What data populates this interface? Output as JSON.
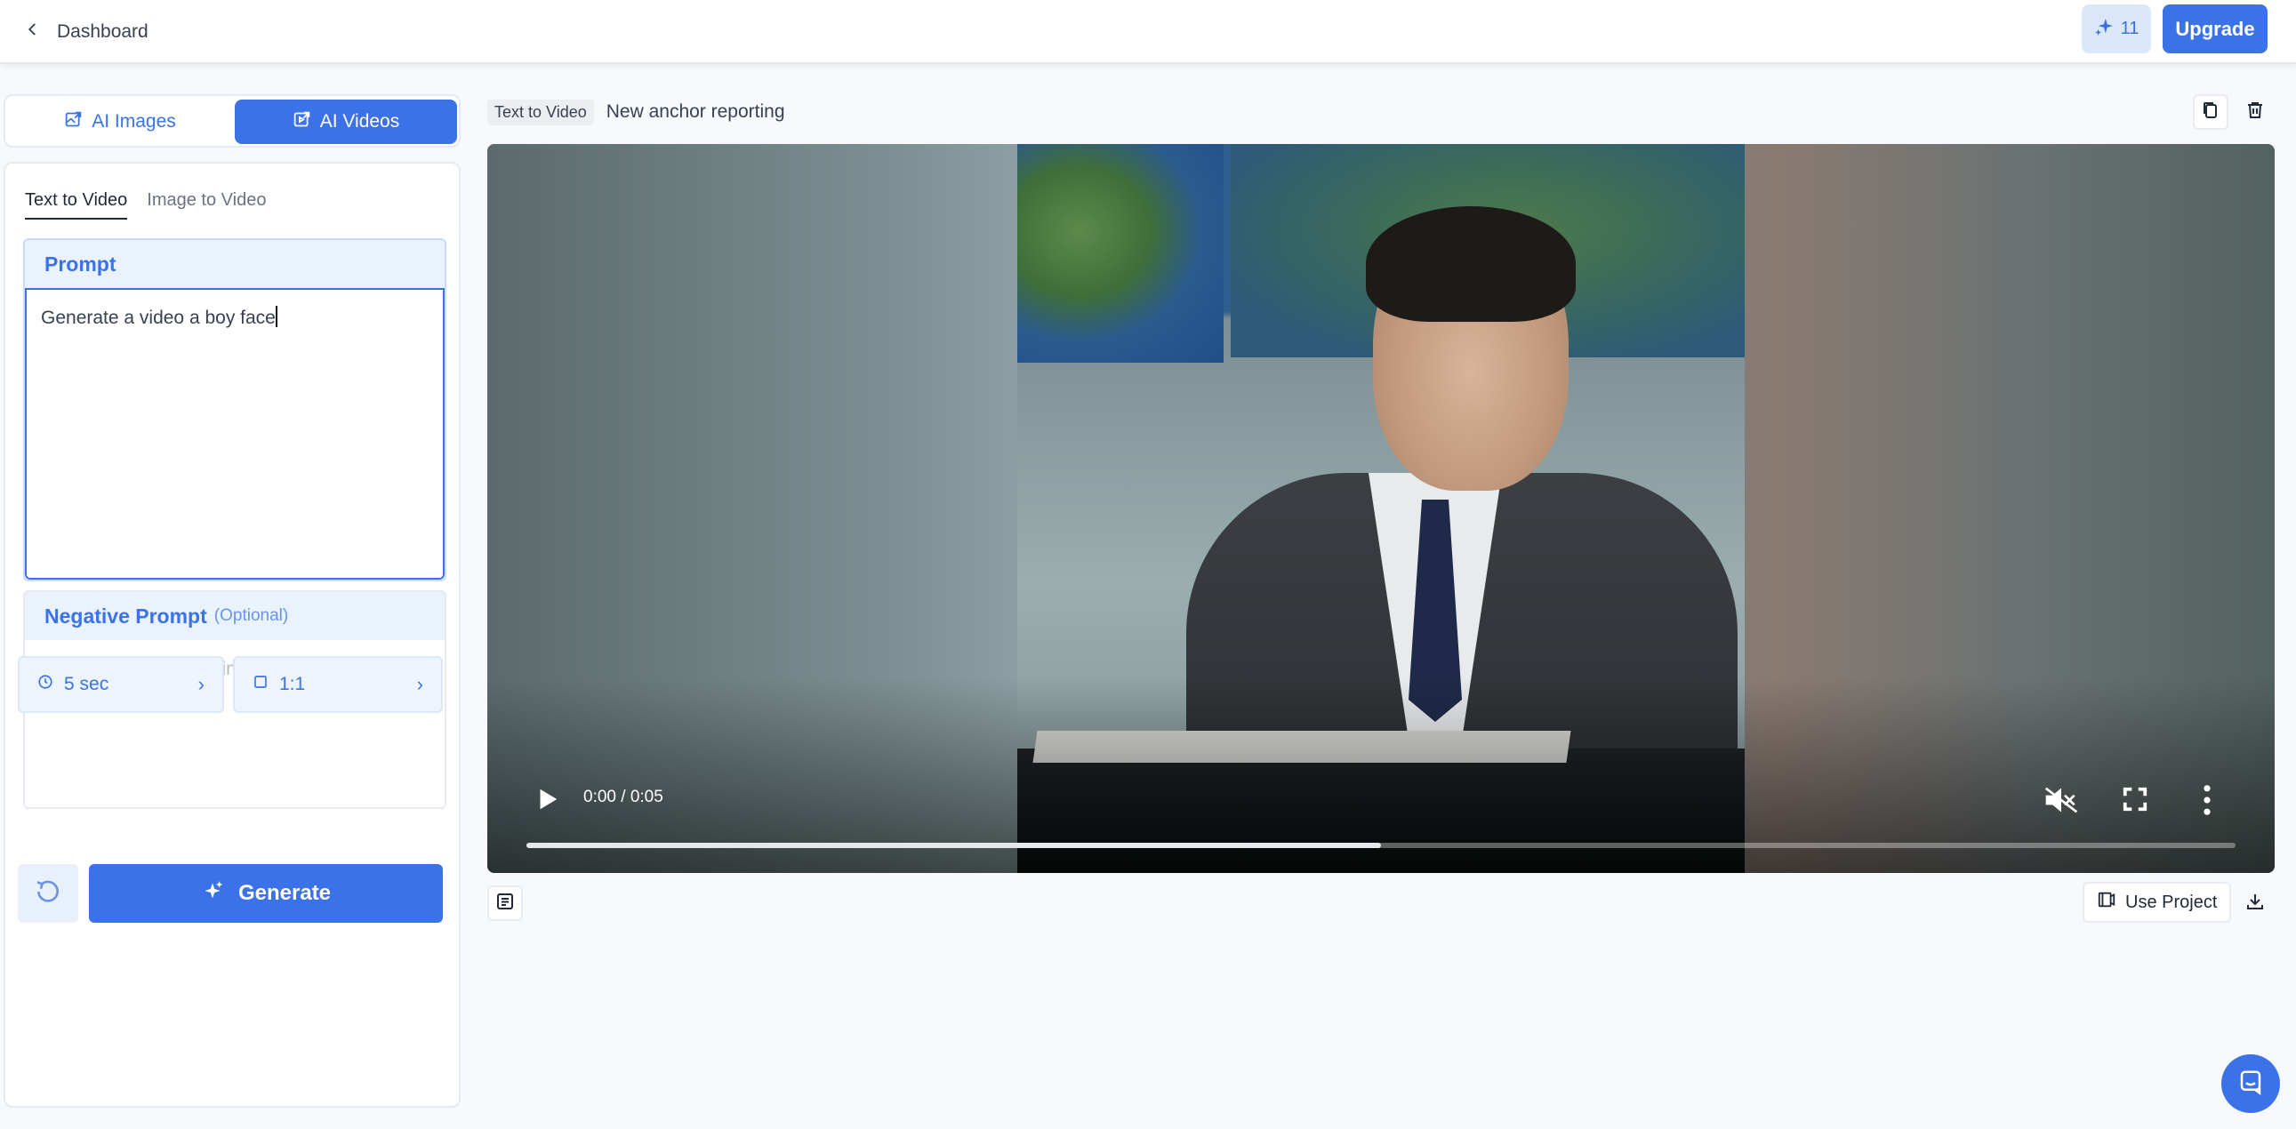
{
  "topbar": {
    "back_label": "Dashboard",
    "credits": "11",
    "upgrade_label": "Upgrade"
  },
  "mode_tabs": {
    "images_label": "AI Images",
    "videos_label": "AI Videos",
    "active": "AI Videos"
  },
  "sub_tabs": {
    "text_to_video": "Text to Video",
    "image_to_video": "Image to Video",
    "active": "Text to Video"
  },
  "prompt": {
    "label": "Prompt",
    "value": "Generate a video a boy face"
  },
  "negative_prompt": {
    "label": "Negative Prompt",
    "optional_label": "(Optional)",
    "placeholder": "Things to avoid in the image/video (e.g. glitch, blur, artifacts)"
  },
  "options": {
    "duration": "5 sec",
    "aspect_ratio": "1:1"
  },
  "actions": {
    "generate_label": "Generate"
  },
  "video": {
    "type_badge": "Text to Video",
    "title": "New anchor reporting",
    "time": "0:00 / 0:05",
    "progress": 0.5,
    "muted": true
  },
  "bottom_actions": {
    "use_project_label": "Use Project"
  },
  "colors": {
    "accent": "#3b72e8",
    "accent_light": "#eaf2fd",
    "background": "#f7f9fc"
  }
}
